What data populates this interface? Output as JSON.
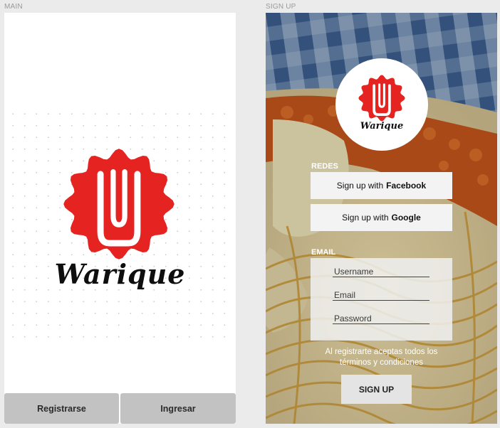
{
  "artboards": {
    "main_label": "MAIN",
    "signup_label": "SIGN UP"
  },
  "main": {
    "brand": "Warique",
    "register_label": "Registrarse",
    "login_label": "Ingresar"
  },
  "signup": {
    "brand": "Warique",
    "redes_label": "REDES",
    "facebook_prefix": "Sign up with",
    "facebook_name": "Facebook",
    "google_prefix": "Sign up with",
    "google_name": "Google",
    "email_label": "EMAIL",
    "username_placeholder": "Username",
    "email_placeholder": "Email",
    "password_placeholder": "Password",
    "terms_line1": "Al registrarte aceptas todos los",
    "terms_line2": "términos y condiciones",
    "signup_button": "SIGN UP"
  },
  "colors": {
    "brand_red": "#e52421",
    "button_gray": "#c2c2c2"
  },
  "icons": {
    "logo": "warique-badge-icon"
  }
}
